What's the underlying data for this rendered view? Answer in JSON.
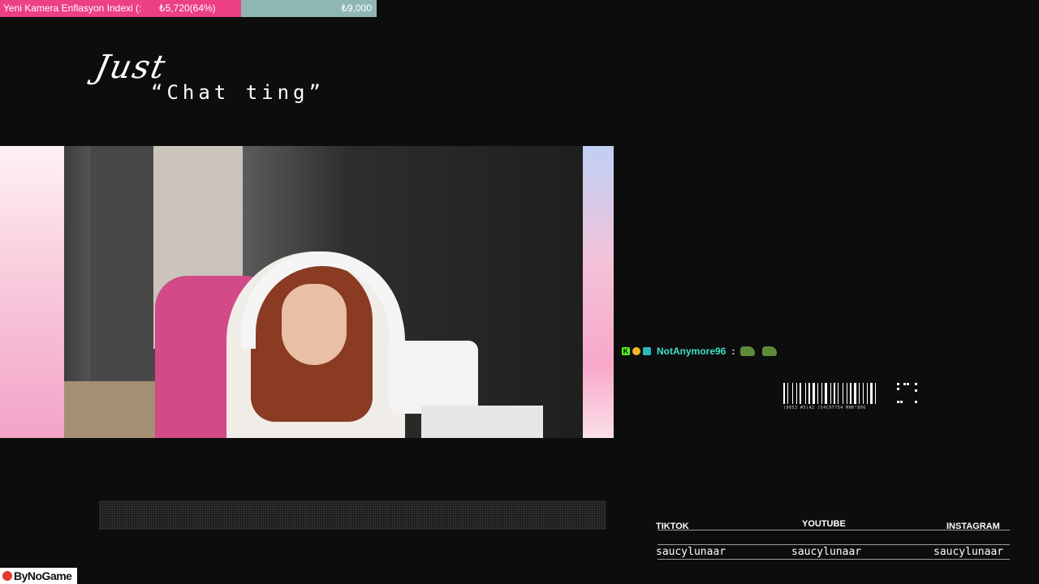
{
  "goal": {
    "title": "Yeni Kamera Enflasyon Indexi (:",
    "current": "₺5,720(64%)",
    "target": "₺9,000",
    "progress": 0.64,
    "fill_color": "#ec3f86",
    "track_color": "#8fb6b4"
  },
  "title": {
    "just": "Just",
    "chatting": "“Chat ting”"
  },
  "chat": {
    "username": "NotAnymore96",
    "separator": ":",
    "username_color": "#40e0c8",
    "badges": [
      "kick-badge",
      "gold-badge",
      "sub-badge"
    ],
    "emotes": [
      "frog-emote",
      "frog-emote"
    ]
  },
  "barcode": {
    "text": "(9053 #5)A2 )54C97754 MHK°806"
  },
  "socials": {
    "tiktok": {
      "label": "TIKTOK",
      "handle": "saucylunaar"
    },
    "youtube": {
      "label": "YOUTUBE",
      "handle": "saucylunaar"
    },
    "instagram": {
      "label": "INSTAGRAM",
      "handle": "saucylunaar"
    }
  },
  "watermark": {
    "text": "ByNoGame"
  }
}
